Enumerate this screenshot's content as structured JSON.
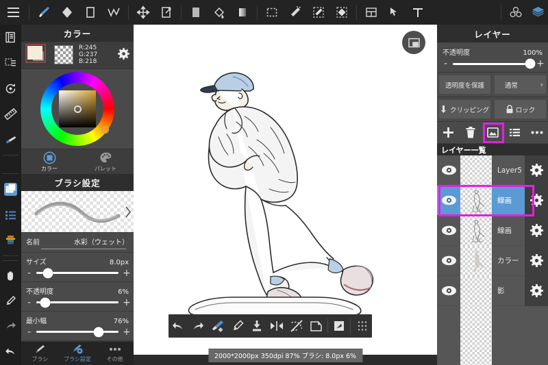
{
  "toolbar": {
    "menu_icon": "hamburger-menu-icon",
    "tools": [
      {
        "name": "brush-tool",
        "icon": "paintbrush-icon",
        "active": true
      },
      {
        "name": "eraser-tool",
        "icon": "eraser-diamond-icon",
        "active": false
      },
      {
        "name": "shape-tool",
        "icon": "rectangle-icon",
        "active": false
      },
      {
        "name": "polyline-tool",
        "icon": "polyline-check-icon",
        "active": false
      },
      {
        "name": "move-tool",
        "icon": "move-arrows-icon",
        "active": false
      },
      {
        "name": "transform-tool",
        "icon": "transform-icon",
        "active": false
      },
      {
        "name": "fill-solid-tool",
        "icon": "solid-fill-icon",
        "active": false
      },
      {
        "name": "bucket-tool",
        "icon": "paint-bucket-icon",
        "active": false
      },
      {
        "name": "gradient-tool",
        "icon": "gradient-icon",
        "active": false
      },
      {
        "name": "select-rect-tool",
        "icon": "marquee-select-icon",
        "active": false
      },
      {
        "name": "magic-wand-tool",
        "icon": "magic-wand-icon",
        "active": false
      },
      {
        "name": "select-pen-tool",
        "icon": "select-pen-icon",
        "active": false
      },
      {
        "name": "select-eraser-tool",
        "icon": "select-eraser-icon",
        "active": false
      },
      {
        "name": "material-tool",
        "icon": "material-panel-icon",
        "active": false
      },
      {
        "name": "cursor-tool",
        "icon": "cursor-arrow-icon",
        "active": false
      },
      {
        "name": "text-tool",
        "icon": "text-T-icon",
        "active": false
      }
    ],
    "right_tools": [
      {
        "name": "3d-model-button",
        "icon": "three-spheres-icon"
      },
      {
        "name": "layers-button",
        "icon": "layers-stack-icon"
      }
    ]
  },
  "rail": {
    "items": [
      {
        "name": "rail-file",
        "icon": "document-icon"
      },
      {
        "name": "rail-selection",
        "icon": "selection-list-icon"
      },
      {
        "name": "rail-rotate",
        "icon": "rotate-canvas-icon"
      },
      {
        "name": "rail-ruler",
        "icon": "ruler-icon"
      },
      {
        "name": "rail-brush",
        "icon": "brush-blue-icon"
      },
      {
        "name": "rail-canvas",
        "icon": "canvas-layers-icon"
      },
      {
        "name": "rail-list",
        "icon": "blue-list-icon"
      },
      {
        "name": "rail-color-bars",
        "icon": "color-bars-icon"
      },
      {
        "name": "rail-hand",
        "icon": "hand-icon"
      },
      {
        "name": "rail-pen",
        "icon": "pen-icon"
      },
      {
        "name": "rail-redo",
        "icon": "redo-arrow-icon"
      },
      {
        "name": "rail-undo",
        "icon": "undo-arrow-icon"
      }
    ]
  },
  "color_panel": {
    "title": "カラー",
    "rgb": {
      "r_label": "R:245",
      "g_label": "G:237",
      "b_label": "B:218"
    },
    "foreground_hex": "#f5edda",
    "background_hex": "#8d8d8d",
    "settings_icon": "gear-icon",
    "tabs": [
      {
        "label": "カラー",
        "icon": "color-square-icon",
        "active": true
      },
      {
        "label": "パレット",
        "icon": "palette-icon",
        "active": false
      }
    ]
  },
  "brush_panel": {
    "title": "ブラシ設定",
    "prev_icon": "chevron-left-icon",
    "next_icon": "chevron-right-icon",
    "name_label": "名前",
    "name_value": "水彩（ウェット）",
    "settings": [
      {
        "label": "サイズ",
        "value": "8.0px",
        "percent": 14,
        "minus": "-",
        "plus": "+"
      },
      {
        "label": "不透明度",
        "value": "6%",
        "percent": 11,
        "minus": "-",
        "plus": "+"
      },
      {
        "label": "最小幅",
        "value": "76%",
        "percent": 76,
        "minus": "-",
        "plus": "+"
      }
    ],
    "tabs": [
      {
        "label": "ブラシ",
        "icon": "brush-icon",
        "active": false
      },
      {
        "label": "ブラシ設定",
        "icon": "brush-gear-icon",
        "active": true
      },
      {
        "label": "その他",
        "icon": "more-dots-icon",
        "active": false
      }
    ]
  },
  "canvas": {
    "fab_icon": "minimize-window-icon",
    "artwork_alt": "skateboarder-line-art"
  },
  "bottom_toolbar": {
    "buttons": [
      {
        "name": "undo-button",
        "icon": "undo-arrow-icon"
      },
      {
        "name": "redo-button",
        "icon": "redo-arrow-icon"
      },
      {
        "name": "brush-swap-button",
        "icon": "brush-swap-icon",
        "active": true
      },
      {
        "name": "eyedropper-button",
        "icon": "eyedropper-icon"
      },
      {
        "name": "merge-down-button",
        "icon": "merge-down-icon"
      },
      {
        "name": "flip-horizontal-button",
        "icon": "flip-horizontal-icon"
      },
      {
        "name": "clear-selection-button",
        "icon": "deselect-icon"
      },
      {
        "name": "transform-select-button",
        "icon": "select-transform-icon"
      },
      {
        "name": "fullscreen-button",
        "icon": "expand-arrow-icon"
      },
      {
        "name": "grid-handle-button",
        "icon": "drag-grid-icon"
      }
    ]
  },
  "statusbar": {
    "text": "2000*2000px 350dpi 87% ブラシ: 8.0px 6%"
  },
  "layer_panel": {
    "title": "レイヤー",
    "opacity_label": "不透明度",
    "opacity_value": "100%",
    "opacity_percent": 100,
    "minus": "-",
    "plus": "+",
    "lock_alpha_label": "透明度を保護",
    "blend_mode_label": "通常",
    "blend_chevron": "›",
    "clipping_label": "クリッピング",
    "clipping_icon": "clipping-arrow-icon",
    "lock_label": "ロック",
    "lock_icon": "padlock-icon",
    "actions": [
      {
        "name": "add-layer-button",
        "icon": "plus-icon"
      },
      {
        "name": "delete-layer-button",
        "icon": "trash-icon"
      },
      {
        "name": "duplicate-layer-button",
        "icon": "image-copy-icon",
        "highlighted": true
      },
      {
        "name": "layer-menu-button",
        "icon": "list-icon"
      },
      {
        "name": "more-options-button",
        "icon": "more-dots-icon"
      }
    ],
    "list_title": "レイヤー一覧",
    "layers": [
      {
        "name": "Layer5",
        "visible": true,
        "selected": false,
        "has_art": false,
        "eye_icon": "eye-icon",
        "gear_icon": "gear-icon"
      },
      {
        "name": "線画",
        "visible": true,
        "selected": true,
        "has_art": true,
        "eye_icon": "eye-icon",
        "gear_icon": "gear-icon"
      },
      {
        "name": "線画",
        "visible": true,
        "selected": false,
        "has_art": true,
        "eye_icon": "eye-icon",
        "gear_icon": "gear-icon"
      },
      {
        "name": "カラー",
        "visible": true,
        "selected": false,
        "has_art": true,
        "eye_icon": "eye-icon",
        "gear_icon": "gear-icon"
      },
      {
        "name": "影",
        "visible": true,
        "selected": false,
        "has_art": true,
        "eye_icon": "eye-icon",
        "gear_icon": "gear-icon"
      }
    ]
  },
  "colors": {
    "highlight": "#e61ee6",
    "selection_blue": "#5b9bd5",
    "panel_bg": "#4a4a4a",
    "toolbar_bg": "#232323",
    "accent_blue": "#5b9bd5"
  }
}
